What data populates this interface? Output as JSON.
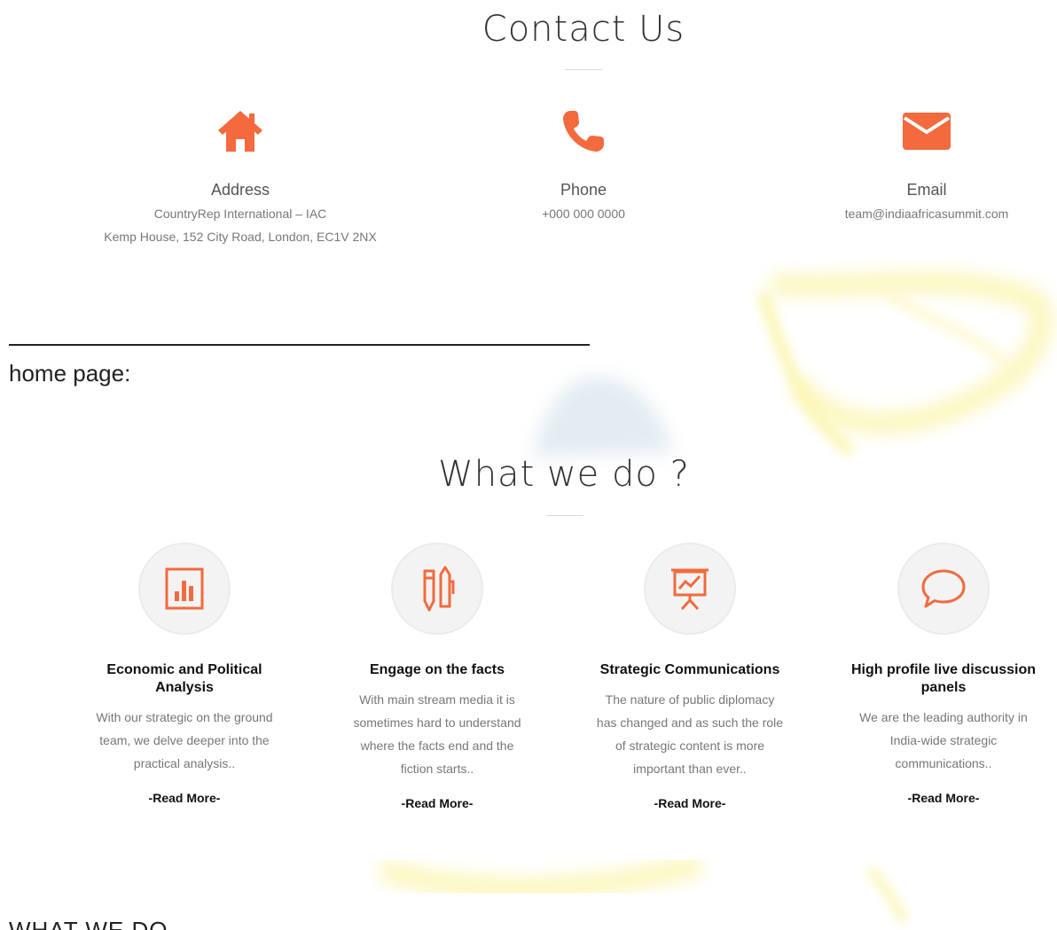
{
  "contact": {
    "title": "Contact Us",
    "address": {
      "label": "Address",
      "line1": "CountryRep International – IAC",
      "line2": "Kemp House, 152 City Road, London, EC1V 2NX"
    },
    "phone": {
      "label": "Phone",
      "value": "+000 000 0000"
    },
    "email": {
      "label": "Email",
      "value": "team@indiaafricasummit.com"
    }
  },
  "doc": {
    "home_label": "home page:",
    "what_we_do_caps": "WHAT WE DO"
  },
  "what_we_do": {
    "title": "What we do ?",
    "cards": [
      {
        "title": "Economic and Political Analysis",
        "text": "With our strategic on the ground team, we delve deeper into the practical analysis..",
        "read_more": "-Read More-"
      },
      {
        "title": "Engage on the facts",
        "text": "With main stream media it is sometimes hard to understand where the facts end and the fiction starts..",
        "read_more": "-Read More-"
      },
      {
        "title": "Strategic Communications",
        "text": "The nature of public diplomacy has changed and as such the role of strategic content is more important than ever..",
        "read_more": "-Read More-"
      },
      {
        "title": "High profile live discussion panels",
        "text": "We are the leading authority in India-wide strategic communications..",
        "read_more": "-Read More-"
      }
    ]
  },
  "colors": {
    "accent": "#f26a3d",
    "watermark_yellow": "#f8ef7a",
    "watermark_blue": "#a9c6d8"
  }
}
